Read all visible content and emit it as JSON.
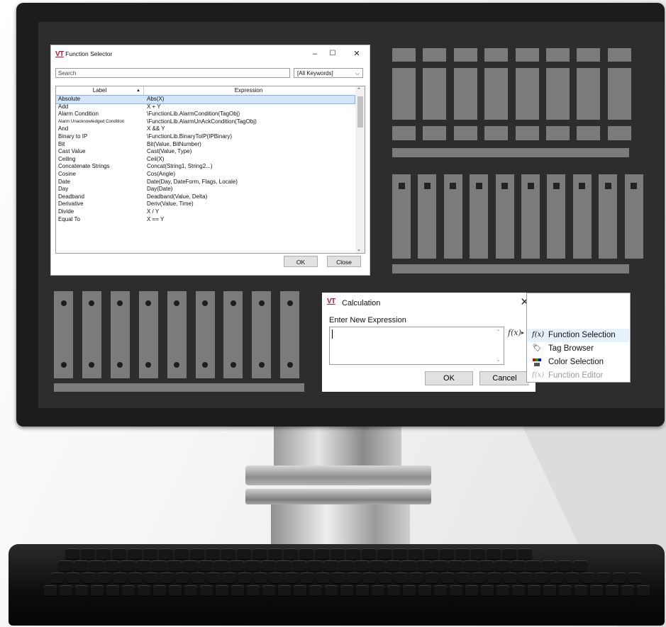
{
  "function_selector": {
    "title": "Function Selector",
    "logo_text": "VT",
    "window_buttons": {
      "minimize": "–",
      "maximize": "☐",
      "close": "✕"
    },
    "search_placeholder": "Search",
    "keyword_filter": "[All Keywords]",
    "columns": [
      "Label",
      "Expression"
    ],
    "rows": [
      {
        "label": "Absolute",
        "expression": "Abs(X)",
        "selected": true
      },
      {
        "label": "Add",
        "expression": "X + Y"
      },
      {
        "label": "Alarm Condition",
        "expression": "\\FunctionLib.AlarmCondition(TagObj)"
      },
      {
        "label": "Alarm Unacknowledged Condition",
        "expression": "\\FunctionLib.AlarmUnAckCondition(TagObj)",
        "small": true
      },
      {
        "label": "And",
        "expression": "X && Y"
      },
      {
        "label": "Binary to IP",
        "expression": "\\FunctionLib.BinaryToIP(IPBinary)"
      },
      {
        "label": "Bit",
        "expression": "Bit(Value, BitNumber)"
      },
      {
        "label": "Cast Value",
        "expression": "Cast(Value, Type)"
      },
      {
        "label": "Ceiling",
        "expression": "Ceil(X)"
      },
      {
        "label": "Concatenate Strings",
        "expression": "Concat(String1, String2...)"
      },
      {
        "label": "Cosine",
        "expression": "Cos(Angle)"
      },
      {
        "label": "Date",
        "expression": "Date(Day, DateForm, Flags, Locale)"
      },
      {
        "label": "Day",
        "expression": "Day(Date)"
      },
      {
        "label": "Deadband",
        "expression": "Deadband(Value, Delta)"
      },
      {
        "label": "Derivative",
        "expression": "Deriv(Value, Time)"
      },
      {
        "label": "Divide",
        "expression": "X / Y"
      },
      {
        "label": "Equal To",
        "expression": "X == Y"
      }
    ],
    "ok_label": "OK",
    "close_label": "Close"
  },
  "calculation": {
    "title": "Calculation",
    "logo_text": "VT",
    "close_glyph": "✕",
    "prompt": "Enter New Expression",
    "expression_value": "",
    "fx_glyph": "f(x)",
    "ok_label": "OK",
    "cancel_label": "Cancel"
  },
  "context_menu": {
    "items": [
      {
        "label": "Function Selection",
        "icon": "function-icon",
        "highlighted": true
      },
      {
        "label": "Tag Browser",
        "icon": "tag-icon"
      },
      {
        "label": "Color Selection",
        "icon": "color-palette-icon"
      },
      {
        "label": "Function Editor",
        "icon": "function-editor-icon",
        "disabled": true
      }
    ]
  },
  "colors": {
    "accent_red": "#c8102e",
    "selection_blue": "#d3e5fa",
    "screen_bg": "#2d2d2d",
    "panel_gray": "#7b7b7b"
  }
}
